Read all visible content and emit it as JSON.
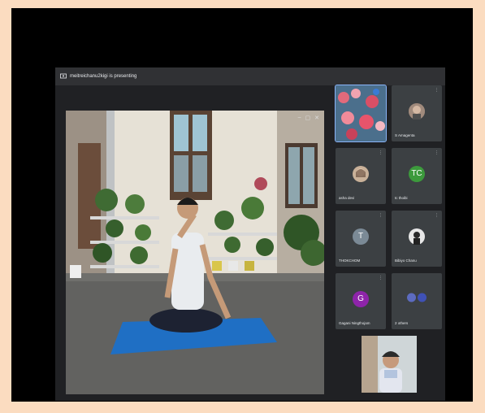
{
  "meeting": {
    "presenting_banner": "meitreichanu2kigi is presenting"
  },
  "participants": [
    {
      "name": "",
      "mic": "",
      "kind": "flowers"
    },
    {
      "name": "S Amagenta",
      "mic": "⋮",
      "kind": "photo-man"
    },
    {
      "name": "asha devi",
      "mic": "⋮",
      "kind": "photo-woman"
    },
    {
      "name": "tc thoibi",
      "mic": "⋮",
      "kind": "letter",
      "letter": "TC",
      "color": "#3c9a3c"
    },
    {
      "name": "THOKCHOM",
      "mic": "⋮",
      "kind": "letter",
      "letter": "T",
      "color": "#7b8a96"
    },
    {
      "name": "Bibiyo Chanu",
      "mic": "⋮",
      "kind": "photo-dark"
    },
    {
      "name": "Gagani Ningthojam",
      "mic": "⋮",
      "kind": "letter",
      "letter": "G",
      "color": "#8e24aa"
    },
    {
      "name": "2 others",
      "mic": "",
      "kind": "pair"
    }
  ],
  "colors": {
    "meet_bg": "#202124",
    "tile_bg": "#3c4043",
    "accent": "#8ab4f8",
    "mat": "#1f6fc4"
  }
}
